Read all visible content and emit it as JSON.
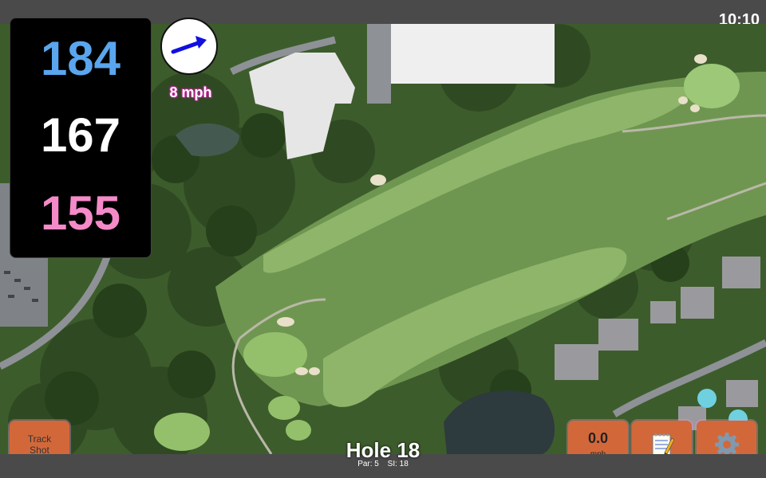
{
  "status": {
    "time": "10:10"
  },
  "distances": {
    "back": "184",
    "middle": "167",
    "front": "155"
  },
  "wind": {
    "speed_label": "8 mph",
    "icon": "wind-arrow-icon",
    "direction": "east-northeast"
  },
  "buttons": {
    "track_shot": {
      "line1": "Track",
      "line2": "Shot"
    },
    "speed": {
      "value": "0.0",
      "unit": "mph"
    },
    "notes": {
      "icon": "notepad-icon"
    },
    "settings": {
      "icon": "gear-icon"
    }
  },
  "hole": {
    "title": "Hole 18",
    "par": "Par: 5",
    "si": "SI: 18"
  },
  "colors": {
    "back": "#5aa6ee",
    "middle": "#ffffff",
    "front": "#f58ac8",
    "button": "#d2683a",
    "wind_text_glow": "#c0269c"
  }
}
